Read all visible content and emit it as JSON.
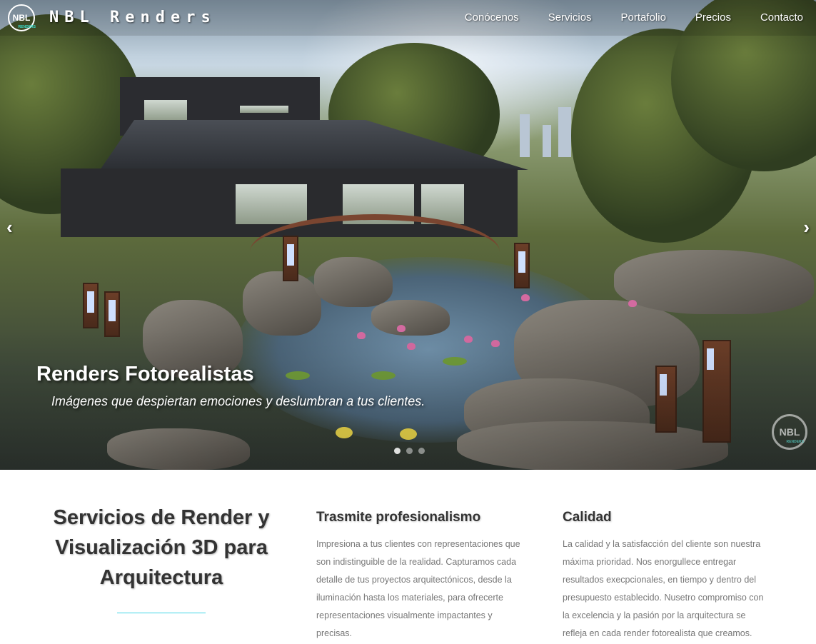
{
  "brand": {
    "badge_text": "NBL",
    "badge_sub": "RENDERS",
    "name": "NBL Renders"
  },
  "nav": {
    "items": [
      "Conócenos",
      "Servicios",
      "Portafolio",
      "Precios",
      "Contacto"
    ]
  },
  "carousel": {
    "prev_icon": "‹",
    "next_icon": "›",
    "title": "Renders Fotorealistas",
    "subtitle": "Imágenes que despiertan emociones y deslumbran a tus clientes.",
    "slide_count": 3,
    "active_slide": 1,
    "watermark_text": "NBL",
    "watermark_sub": "RENDERS"
  },
  "services": {
    "heading": "Servicios de Render y Visualización 3D para Arquitectura",
    "accent_color": "#3fd6e6",
    "columns": [
      {
        "title": "Trasmite profesionalismo",
        "text": "Impresiona a tus clientes con representaciones que son indistinguible de la realidad. Capturamos cada detalle de tus proyectos arquitectónicos, desde la iluminación hasta los materiales, para ofrecerte representaciones visualmente impactantes y precisas."
      },
      {
        "title": "Calidad",
        "text": "La calidad y la satisfacción del cliente son nuestra máxima prioridad. Nos enorgullece entregar resultados execpcionales, en tiempo y dentro del presupuesto establecido. Nusetro compromiso con la excelencia y la pasión por la arquitectura se refleja en cada render fotorealista que creamos."
      }
    ]
  }
}
